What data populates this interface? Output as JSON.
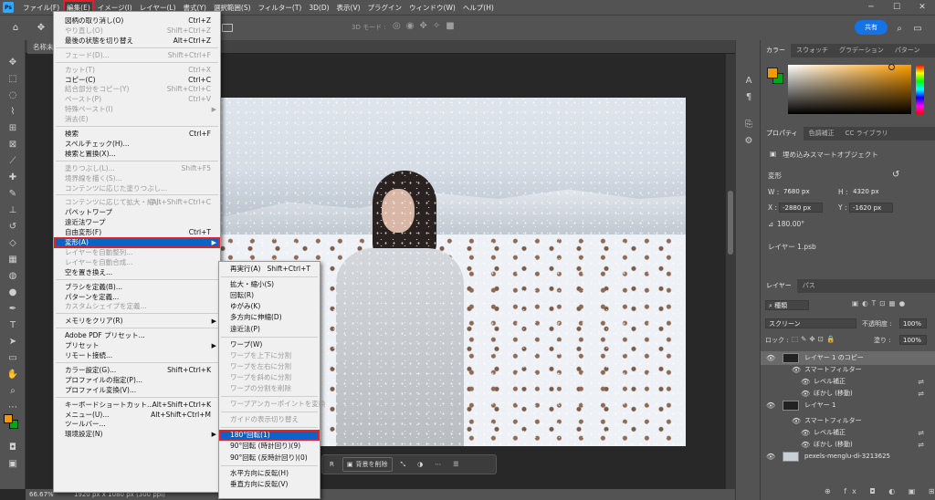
{
  "menubar": {
    "logo": "Ps",
    "items": [
      "ファイル(F)",
      "編集(E)",
      "イメージ(I)",
      "レイヤー(L)",
      "書式(Y)",
      "選択範囲(S)",
      "フィルター(T)",
      "3D(D)",
      "表示(V)",
      "プラグイン",
      "ウィンドウ(W)",
      "ヘルプ(H)"
    ],
    "active_index": 1
  },
  "optionsbar": {
    "mode_3d": "3D モード :",
    "share": "共有"
  },
  "doc_tab": "名称未",
  "status": {
    "zoom": "66.67%",
    "info": "1920 px x 1080 px (300 ppi)"
  },
  "edit_menu": [
    {
      "label": "図柄の取り消し(O)",
      "sc": "Ctrl+Z",
      "dis": false
    },
    {
      "label": "やり直し(O)",
      "sc": "Shift+Ctrl+Z",
      "dis": true
    },
    {
      "label": "最後の状態を切り替え",
      "sc": "Alt+Ctrl+Z",
      "dis": false
    },
    {
      "sep": true
    },
    {
      "label": "フェード(D)...",
      "sc": "Shift+Ctrl+F",
      "dis": true
    },
    {
      "sep": true
    },
    {
      "label": "カット(T)",
      "sc": "Ctrl+X",
      "dis": true
    },
    {
      "label": "コピー(C)",
      "sc": "Ctrl+C",
      "dis": false
    },
    {
      "label": "結合部分をコピー(Y)",
      "sc": "Shift+Ctrl+C",
      "dis": true
    },
    {
      "label": "ペースト(P)",
      "sc": "Ctrl+V",
      "dis": true
    },
    {
      "label": "特殊ペースト(I)",
      "sc": "",
      "dis": true,
      "arrow": true
    },
    {
      "label": "消去(E)",
      "sc": "",
      "dis": true
    },
    {
      "sep": true
    },
    {
      "label": "検索",
      "sc": "Ctrl+F",
      "dis": false
    },
    {
      "label": "スペルチェック(H)...",
      "sc": "",
      "dis": false
    },
    {
      "label": "検索と置換(X)...",
      "sc": "",
      "dis": false
    },
    {
      "sep": true
    },
    {
      "label": "塗りつぶし(L)...",
      "sc": "Shift+F5",
      "dis": true
    },
    {
      "label": "境界線を描く(S)...",
      "sc": "",
      "dis": true
    },
    {
      "label": "コンテンツに応じた塗りつぶし...",
      "sc": "",
      "dis": true
    },
    {
      "sep": true
    },
    {
      "label": "コンテンツに応じて拡大・縮小",
      "sc": "Alt+Shift+Ctrl+C",
      "dis": true
    },
    {
      "label": "パペットワープ",
      "sc": "",
      "dis": false
    },
    {
      "label": "遠近法ワープ",
      "sc": "",
      "dis": false
    },
    {
      "label": "自由変形(F)",
      "sc": "Ctrl+T",
      "dis": false
    },
    {
      "label": "変形(A)",
      "sc": "",
      "dis": false,
      "arrow": true,
      "hl": true
    },
    {
      "label": "レイヤーを自動整列...",
      "sc": "",
      "dis": true
    },
    {
      "label": "レイヤーを自動合成...",
      "sc": "",
      "dis": true
    },
    {
      "label": "空を置き換え...",
      "sc": "",
      "dis": false
    },
    {
      "sep": true
    },
    {
      "label": "ブラシを定義(B)...",
      "sc": "",
      "dis": false
    },
    {
      "label": "パターンを定義...",
      "sc": "",
      "dis": false
    },
    {
      "label": "カスタムシェイプを定義...",
      "sc": "",
      "dis": true
    },
    {
      "sep": true
    },
    {
      "label": "メモリをクリア(R)",
      "sc": "",
      "dis": false,
      "arrow": true
    },
    {
      "sep": true
    },
    {
      "label": "Adobe PDF プリセット...",
      "sc": "",
      "dis": false
    },
    {
      "label": "プリセット",
      "sc": "",
      "dis": false,
      "arrow": true
    },
    {
      "label": "リモート接続...",
      "sc": "",
      "dis": false
    },
    {
      "sep": true
    },
    {
      "label": "カラー設定(G)...",
      "sc": "Shift+Ctrl+K",
      "dis": false
    },
    {
      "label": "プロファイルの指定(P)...",
      "sc": "",
      "dis": false
    },
    {
      "label": "プロファイル変換(V)...",
      "sc": "",
      "dis": false
    },
    {
      "sep": true
    },
    {
      "label": "キーボードショートカット...",
      "sc": "Alt+Shift+Ctrl+K",
      "dis": false
    },
    {
      "label": "メニュー(U)...",
      "sc": "Alt+Shift+Ctrl+M",
      "dis": false
    },
    {
      "label": "ツールバー...",
      "sc": "",
      "dis": false
    },
    {
      "label": "環境設定(N)",
      "sc": "",
      "dis": false,
      "arrow": true
    }
  ],
  "transform_menu": [
    {
      "label": "再実行(A)",
      "sc": "Shift+Ctrl+T",
      "dis": false
    },
    {
      "sep": true
    },
    {
      "label": "拡大・縮小(S)",
      "sc": "",
      "dis": false
    },
    {
      "label": "回転(R)",
      "sc": "",
      "dis": false
    },
    {
      "label": "ゆがみ(K)",
      "sc": "",
      "dis": false
    },
    {
      "label": "多方向に伸縮(D)",
      "sc": "",
      "dis": false
    },
    {
      "label": "遠近法(P)",
      "sc": "",
      "dis": false
    },
    {
      "sep": true
    },
    {
      "label": "ワープ(W)",
      "sc": "",
      "dis": false
    },
    {
      "label": "ワープを上下に分割",
      "sc": "",
      "dis": true
    },
    {
      "label": "ワープを左右に分割",
      "sc": "",
      "dis": true
    },
    {
      "label": "ワープを斜めに分割",
      "sc": "",
      "dis": true
    },
    {
      "label": "ワープの分割を削除",
      "sc": "",
      "dis": true
    },
    {
      "sep": true
    },
    {
      "label": "ワープアンカーポイントを変換",
      "sc": "",
      "dis": true
    },
    {
      "sep": true
    },
    {
      "label": "ガイドの表示切り替え",
      "sc": "",
      "dis": true
    },
    {
      "sep": true
    },
    {
      "label": "180°回転(1)",
      "sc": "",
      "dis": false,
      "hl": true
    },
    {
      "label": "90°回転 (時計回り)(9)",
      "sc": "",
      "dis": false
    },
    {
      "label": "90°回転 (反時計回り)(0)",
      "sc": "",
      "dis": false
    },
    {
      "sep": true
    },
    {
      "label": "水平方向に反転(H)",
      "sc": "",
      "dis": false
    },
    {
      "label": "垂直方向に反転(V)",
      "sc": "",
      "dis": false
    }
  ],
  "context_bar": {
    "remove_bg": "背景を削除"
  },
  "color_panel": {
    "tabs": [
      "カラー",
      "スウォッチ",
      "グラデーション",
      "パターン"
    ],
    "fg": "#f29a00",
    "bg": "#00a61e"
  },
  "props_panel": {
    "tabs": [
      "プロパティ",
      "色調補正",
      "CC ライブラリ"
    ],
    "type": "埋め込みスマートオブジェクト",
    "section": "変形",
    "w_label": "W :",
    "w": "7680 px",
    "h_label": "H :",
    "h": "4320 px",
    "x_label": "X :",
    "x": "-2880 px",
    "y_label": "Y :",
    "y": "-1620 px",
    "angle": "180.00°",
    "layer_file": "レイヤー 1.psb"
  },
  "layers_panel": {
    "tabs": [
      "レイヤー",
      "パス"
    ],
    "kind": "種類",
    "blend": "スクリーン",
    "opacity_label": "不透明度 :",
    "opacity": "100%",
    "lock_label": "ロック :",
    "fill_label": "塗り :",
    "fill": "100%",
    "layers": [
      {
        "name": "レイヤー 1 のコピー",
        "type": "layer",
        "sel": true
      },
      {
        "name": "スマートフィルター",
        "type": "filter"
      },
      {
        "name": "レベル補正",
        "type": "sub"
      },
      {
        "name": "ぼかし (移動)",
        "type": "sub"
      },
      {
        "name": "レイヤー 1",
        "type": "layer",
        "sel": false
      },
      {
        "name": "スマートフィルター",
        "type": "filter"
      },
      {
        "name": "レベル補正",
        "type": "sub"
      },
      {
        "name": "ぼかし (移動)",
        "type": "sub"
      },
      {
        "name": "pexels-menglu-di-3213625",
        "type": "photo"
      }
    ]
  }
}
